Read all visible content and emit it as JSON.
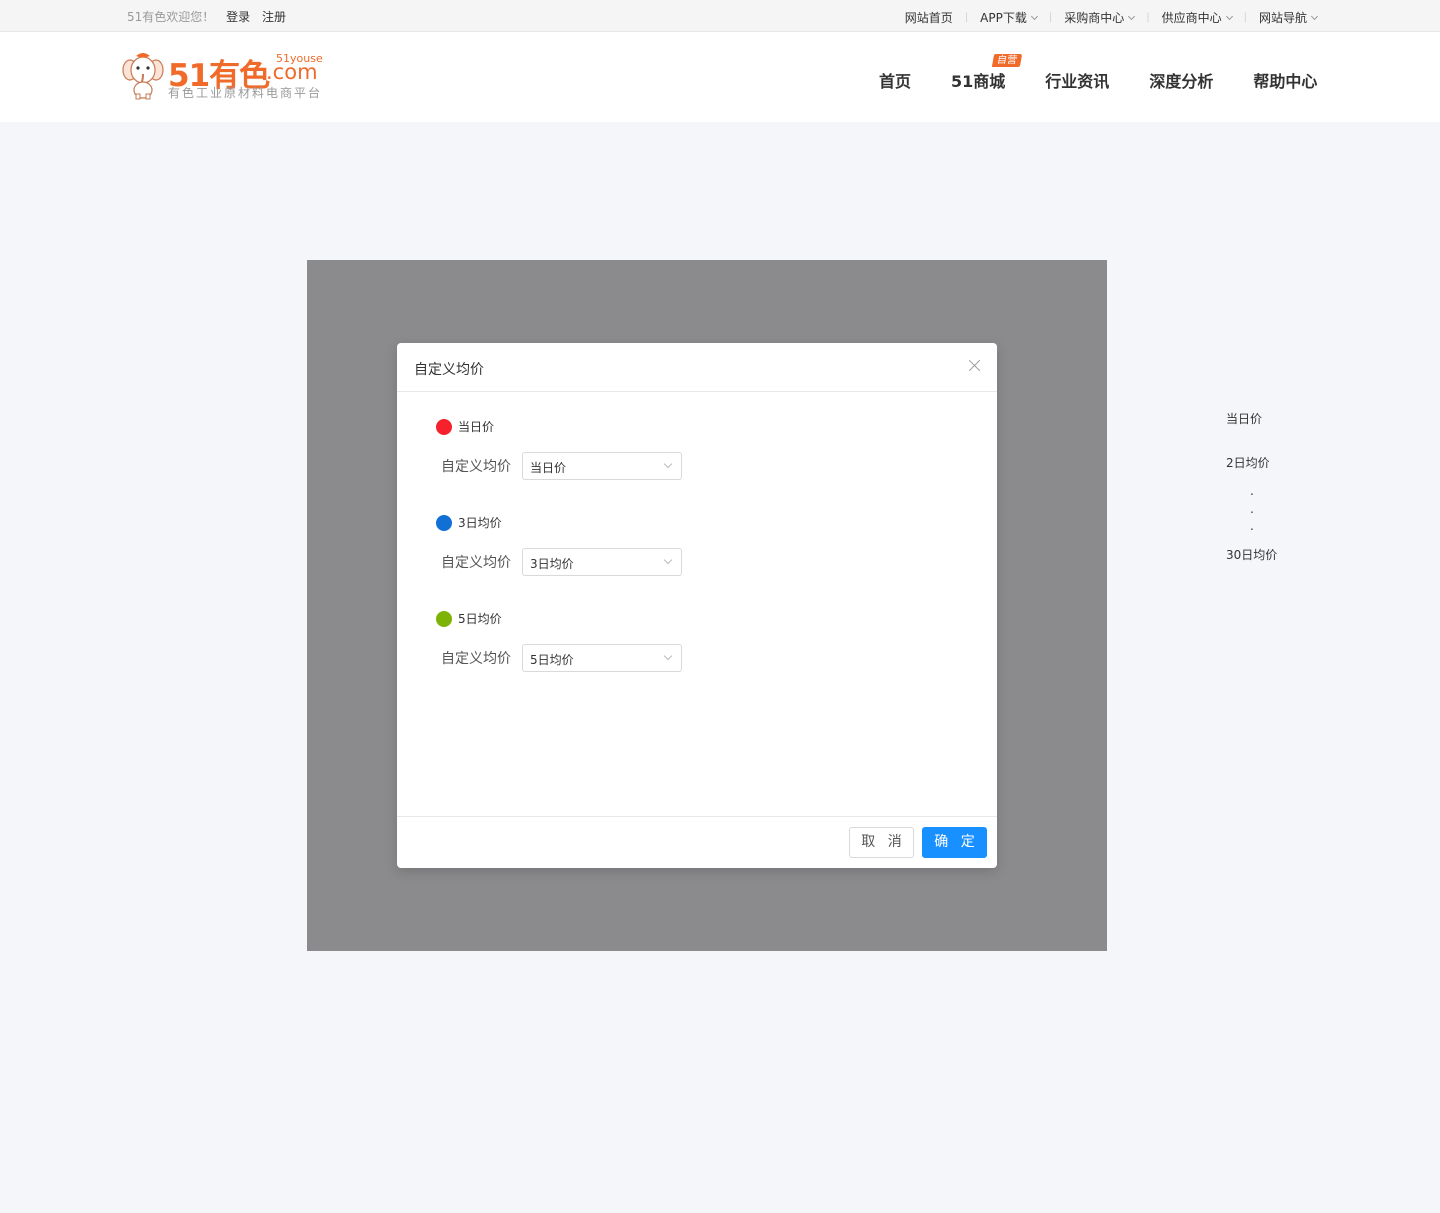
{
  "topbar": {
    "welcome": "51有色欢迎您！",
    "login": "登录",
    "register": "注册",
    "links": [
      "网站首页",
      "APP下载",
      "采购商中心",
      "供应商中心",
      "网站导航"
    ]
  },
  "header": {
    "logo_main": "51有色",
    "logo_com": ".com",
    "logo_sub": "51youse",
    "logo_tagline": "有色工业原材料电商平台",
    "nav": [
      "首页",
      "51商城",
      "行业资讯",
      "深度分析",
      "帮助中心"
    ],
    "nav_badge": "自营"
  },
  "modal": {
    "title": "自定义均价",
    "groups": [
      {
        "title": "当日价",
        "color": "#f5222d",
        "label": "自定义均价",
        "value": "当日价"
      },
      {
        "title": "3日均价",
        "color": "#1170d6",
        "label": "自定义均价",
        "value": "3日均价"
      },
      {
        "title": "5日均价",
        "color": "#7cb305",
        "label": "自定义均价",
        "value": "5日均价"
      }
    ],
    "cancel": "取 消",
    "ok": "确 定"
  },
  "side_list": {
    "item1": "当日价",
    "item2": "2日均价",
    "dots": [
      ".",
      ".",
      "."
    ],
    "item3": "30日均价"
  }
}
